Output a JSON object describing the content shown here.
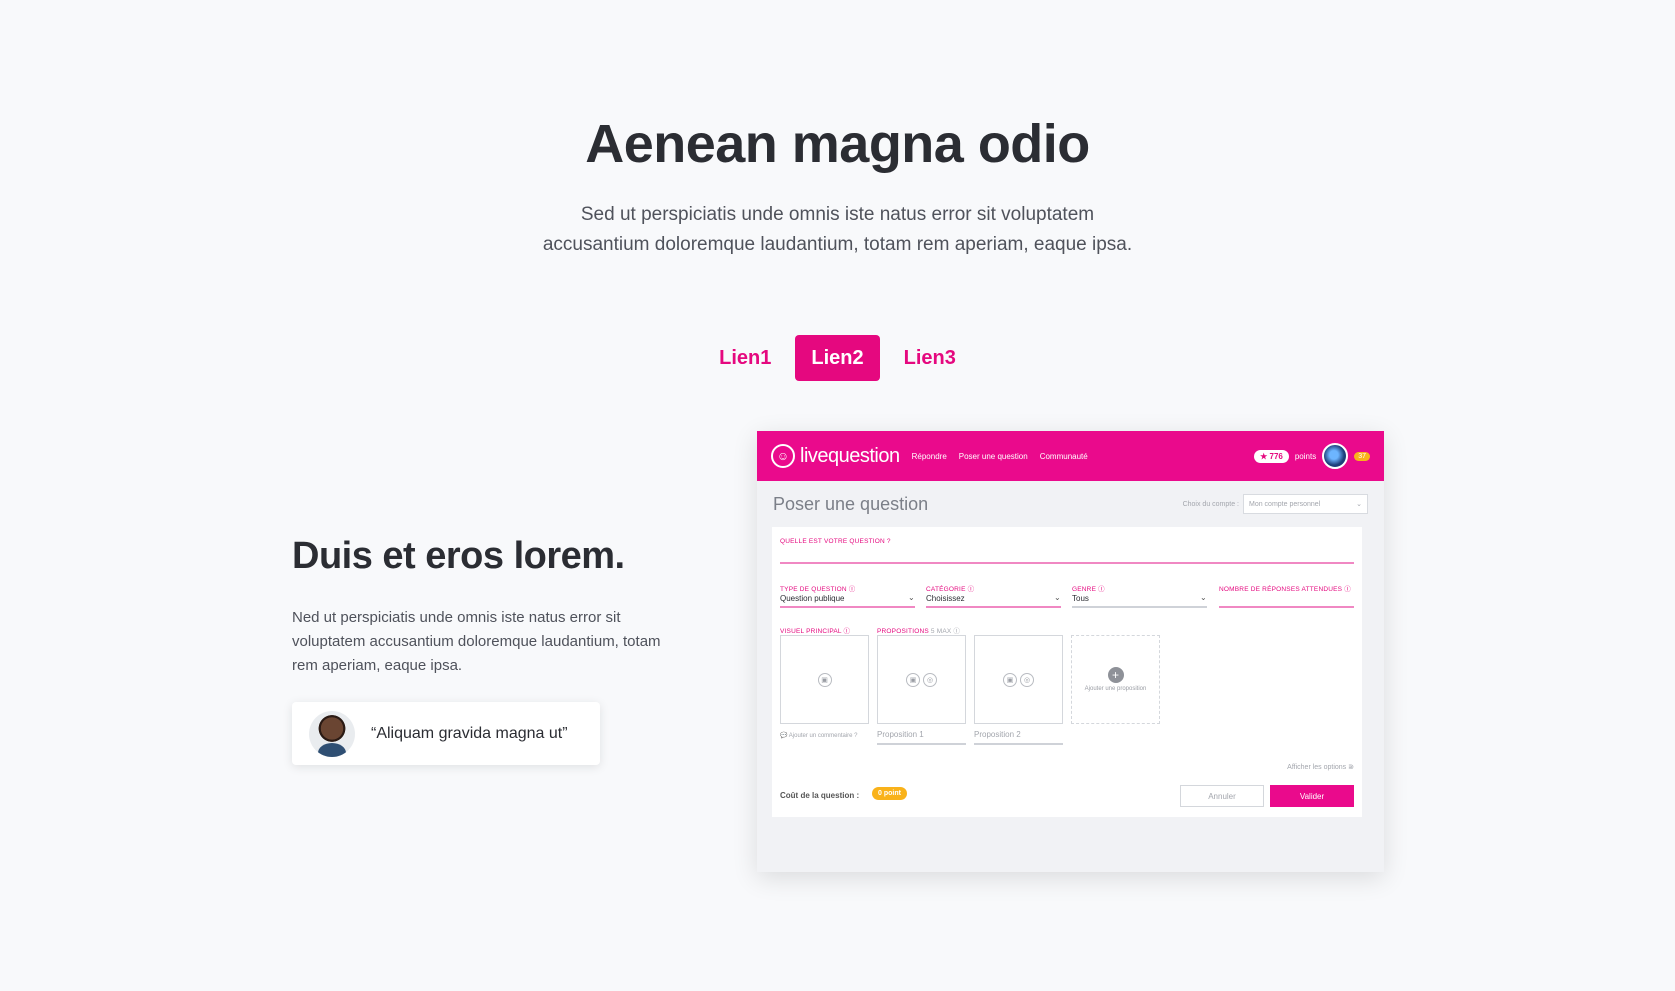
{
  "hero": {
    "title": "Aenean magna odio",
    "subtitle_line1": "Sed ut perspiciatis unde omnis iste natus error sit voluptatem",
    "subtitle_line2": "accusantium doloremque laudantium, totam rem aperiam, eaque ipsa."
  },
  "tabs": [
    {
      "label": "Lien1",
      "active": false
    },
    {
      "label": "Lien2",
      "active": true
    },
    {
      "label": "Lien3",
      "active": false
    }
  ],
  "feature": {
    "title": "Duis et eros lorem.",
    "text": "Ned ut perspiciatis unde omnis iste natus error sit voluptatem accusantium doloremque laudantium, totam rem aperiam, eaque ipsa.",
    "quote": "“Aliquam gravida magna ut”"
  },
  "mockup": {
    "logo": "livequestion",
    "nav": [
      "Répondre",
      "Poser une question",
      "Communauté"
    ],
    "points_value": "★ 776",
    "points_label": "points",
    "notif": "37",
    "page_title": "Poser une question",
    "account_label": "Choix du compte :",
    "account_value": "Mon compte personnel",
    "question_label": "Quelle est votre question ?",
    "type_label": "Type de question ⓘ",
    "type_value": "Question publique",
    "category_label": "Catégorie ⓘ",
    "category_value": "Choisissez",
    "genre_label": "Genre ⓘ",
    "genre_value": "Tous",
    "answers_label": "Nombre de réponses attendues ⓘ",
    "visual_label": "Visuel principal ⓘ",
    "props_label": "Propositions",
    "props_max": "5 max ⓘ",
    "add_prop": "Ajouter une proposition",
    "add_comment": "💬 Ajouter un commentaire ?",
    "prop1": "Proposition 1",
    "prop2": "Proposition 2",
    "options_link": "Afficher les options ⋑",
    "cost_label": "Coût de la question :",
    "cost_value": "0 point",
    "cancel": "Annuler",
    "submit": "Valider"
  },
  "colors": {
    "accent": "#e5087f",
    "background": "#f8f9fb",
    "badge": "#f9b21a"
  }
}
